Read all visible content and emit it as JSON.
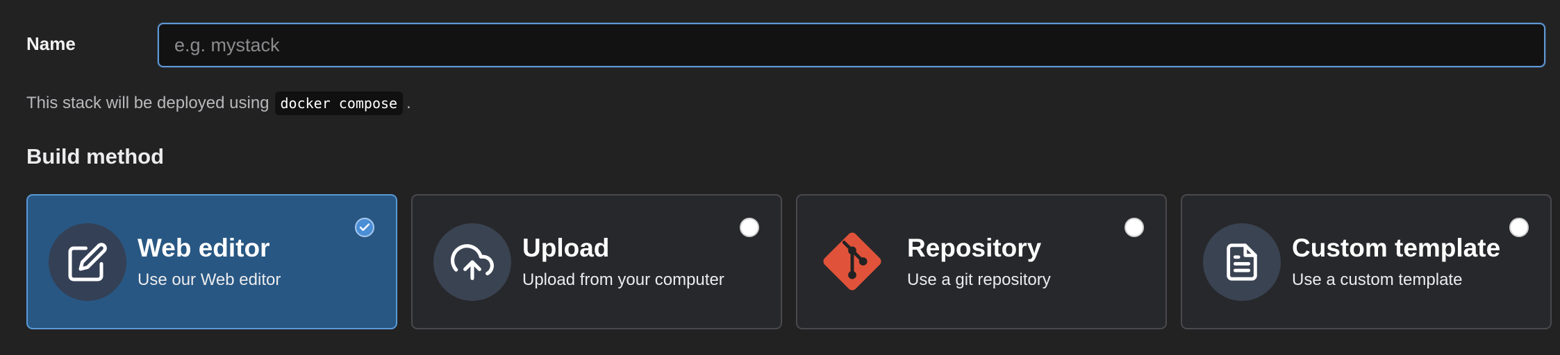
{
  "form": {
    "name_label": "Name",
    "name_placeholder": "e.g. mystack",
    "name_value": "",
    "hint_prefix": "This stack will be deployed using",
    "hint_code": "docker compose",
    "hint_suffix": "."
  },
  "build_method": {
    "title": "Build method",
    "selected": "web-editor",
    "options": [
      {
        "id": "web-editor",
        "title": "Web editor",
        "description": "Use our Web editor",
        "icon": "edit-icon",
        "selected": true
      },
      {
        "id": "upload",
        "title": "Upload",
        "description": "Upload from your computer",
        "icon": "cloud-upload-icon",
        "selected": false
      },
      {
        "id": "repository",
        "title": "Repository",
        "description": "Use a git repository",
        "icon": "git-icon",
        "selected": false
      },
      {
        "id": "custom-template",
        "title": "Custom template",
        "description": "Use a custom template",
        "icon": "file-text-icon",
        "selected": false
      }
    ]
  },
  "colors": {
    "background": "#222223",
    "accent": "#4a8fd6",
    "selected_card": "#285783",
    "git_brand": "#e0533a"
  }
}
